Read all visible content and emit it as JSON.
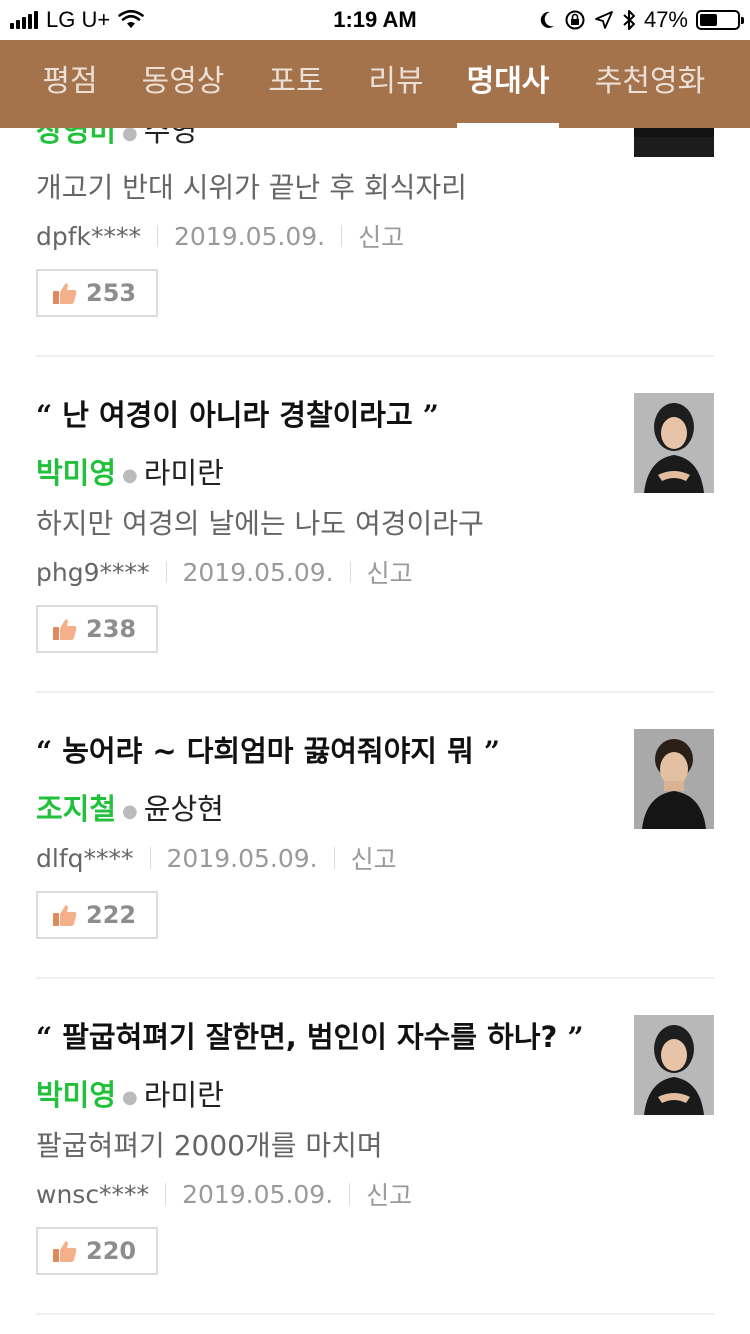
{
  "status_bar": {
    "carrier": "LG U+",
    "time": "1:19 AM",
    "battery": "47%",
    "battery_level": 0.47
  },
  "tabs": [
    {
      "label": "평점",
      "active": false
    },
    {
      "label": "동영상",
      "active": false
    },
    {
      "label": "포토",
      "active": false
    },
    {
      "label": "리뷰",
      "active": false
    },
    {
      "label": "명대사",
      "active": true
    },
    {
      "label": "추천영화",
      "active": false
    }
  ],
  "colors": {
    "nav_bg": "#a5734b",
    "actor_green": "#21c13b",
    "divider": "#efefef"
  },
  "quotes": [
    {
      "actor": "장영미",
      "role": "주영",
      "desc": "개고기 반대 시위가 끝난 후 회식자리",
      "user": "dpfk****",
      "date": "2019.05.09.",
      "report": "신고",
      "likes": "253"
    },
    {
      "quote": "난 여경이 아니라 경찰이라고",
      "actor": "박미영",
      "role": "라미란",
      "desc": "하지만 여경의 날에는 나도 여경이라구",
      "user": "phg9****",
      "date": "2019.05.09.",
      "report": "신고",
      "likes": "238"
    },
    {
      "quote": "농어랴 ~ 다희엄마 끓여줘야지 뭐",
      "actor": "조지철",
      "role": "윤상현",
      "desc": "",
      "user": "dlfq****",
      "date": "2019.05.09.",
      "report": "신고",
      "likes": "222"
    },
    {
      "quote": "팔굽혀펴기 잘한면, 범인이 자수를 하나?",
      "actor": "박미영",
      "role": "라미란",
      "desc": "팔굽혀펴기 2000개를 마치며",
      "user": "wnsc****",
      "date": "2019.05.09.",
      "report": "신고",
      "likes": "220"
    }
  ],
  "icons": {
    "like": "thumbs-up-icon",
    "wifi": "wifi-icon",
    "moon": "moon-icon",
    "location": "location-arrow-icon",
    "bluetooth": "bluetooth-icon",
    "lock": "orientation-lock-icon"
  }
}
